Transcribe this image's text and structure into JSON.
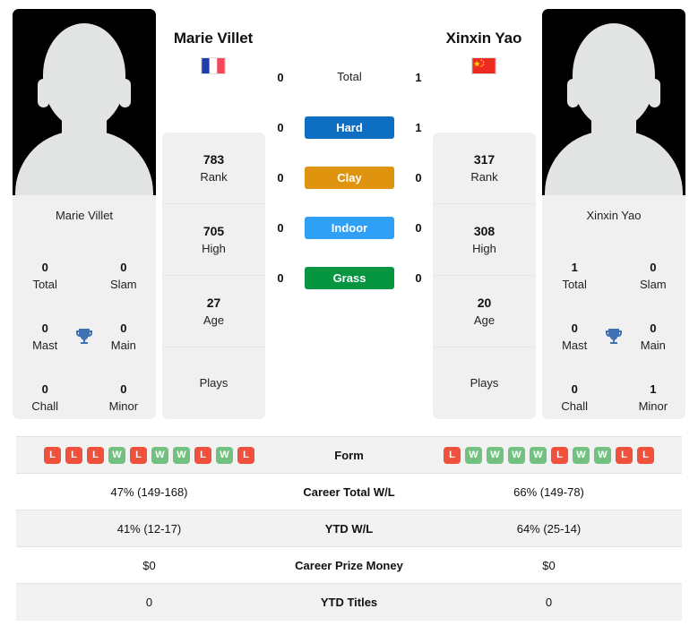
{
  "players": {
    "left": {
      "name": "Marie Villet",
      "photo_caption": "Marie Villet",
      "flag": "france-flag",
      "titles": {
        "total_value": "0",
        "total_label": "Total",
        "slam_value": "0",
        "slam_label": "Slam",
        "mast_value": "0",
        "mast_label": "Mast",
        "main_value": "0",
        "main_label": "Main",
        "chall_value": "0",
        "chall_label": "Chall",
        "minor_value": "0",
        "minor_label": "Minor"
      },
      "stats": {
        "rank_value": "783",
        "rank_label": "Rank",
        "high_value": "705",
        "high_label": "High",
        "age_value": "27",
        "age_label": "Age",
        "plays_value": "",
        "plays_label": "Plays"
      },
      "form": [
        "L",
        "L",
        "L",
        "W",
        "L",
        "W",
        "W",
        "L",
        "W",
        "L"
      ],
      "career_wl": "47% (149-168)",
      "ytd_wl": "41% (12-17)",
      "career_prize_money": "$0",
      "ytd_titles": "0"
    },
    "right": {
      "name": "Xinxin Yao",
      "photo_caption": "Xinxin Yao",
      "flag": "china-flag",
      "titles": {
        "total_value": "1",
        "total_label": "Total",
        "slam_value": "0",
        "slam_label": "Slam",
        "mast_value": "0",
        "mast_label": "Mast",
        "main_value": "0",
        "main_label": "Main",
        "chall_value": "0",
        "chall_label": "Chall",
        "minor_value": "1",
        "minor_label": "Minor"
      },
      "stats": {
        "rank_value": "317",
        "rank_label": "Rank",
        "high_value": "308",
        "high_label": "High",
        "age_value": "20",
        "age_label": "Age",
        "plays_value": "",
        "plays_label": "Plays"
      },
      "form": [
        "L",
        "W",
        "W",
        "W",
        "W",
        "L",
        "W",
        "W",
        "L",
        "L"
      ],
      "career_wl": "66% (149-78)",
      "ytd_wl": "64% (25-14)",
      "career_prize_money": "$0",
      "ytd_titles": "0"
    }
  },
  "head_to_head": [
    {
      "label": "Total",
      "left": "0",
      "right": "1",
      "badge": false,
      "color": ""
    },
    {
      "label": "Hard",
      "left": "0",
      "right": "1",
      "badge": true,
      "color": "#0e6fc2"
    },
    {
      "label": "Clay",
      "left": "0",
      "right": "0",
      "badge": true,
      "color": "#df930f"
    },
    {
      "label": "Indoor",
      "left": "0",
      "right": "0",
      "badge": true,
      "color": "#2fa0f5"
    },
    {
      "label": "Grass",
      "left": "0",
      "right": "0",
      "badge": true,
      "color": "#069641"
    }
  ],
  "table_rows": [
    {
      "label": "Form",
      "key": "form",
      "type": "form"
    },
    {
      "label": "Career Total W/L",
      "key": "career_wl",
      "type": "text"
    },
    {
      "label": "YTD W/L",
      "key": "ytd_wl",
      "type": "text"
    },
    {
      "label": "Career Prize Money",
      "key": "career_prize_money",
      "type": "text"
    },
    {
      "label": "YTD Titles",
      "key": "ytd_titles",
      "type": "text"
    }
  ],
  "colors": {
    "win": "#73c180",
    "loss": "#ef513c",
    "trophy": "#3f72b4",
    "card_bg": "#f0f0f0"
  }
}
